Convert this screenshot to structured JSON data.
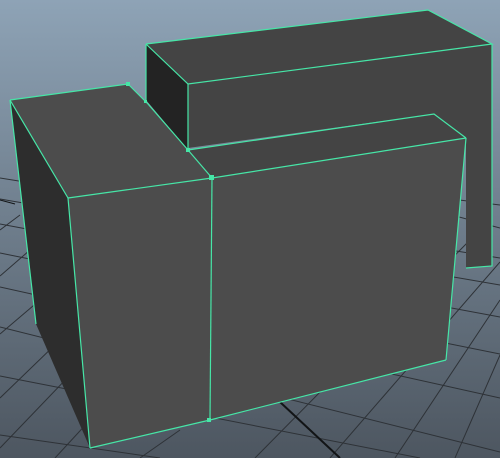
{
  "viewport": {
    "background_top": "#8ea3b6",
    "background_bottom": "#4d5660"
  },
  "grid": {
    "line_color": "#2e3237",
    "axis_color": "#121416"
  },
  "mesh": {
    "edge_color": "#46e6a7",
    "vertex_color": "#46e6a7",
    "face_light": "#4c4c4c",
    "face_mid": "#444444",
    "face_dark": "#2d2d2d",
    "face_darkest": "#232323"
  }
}
